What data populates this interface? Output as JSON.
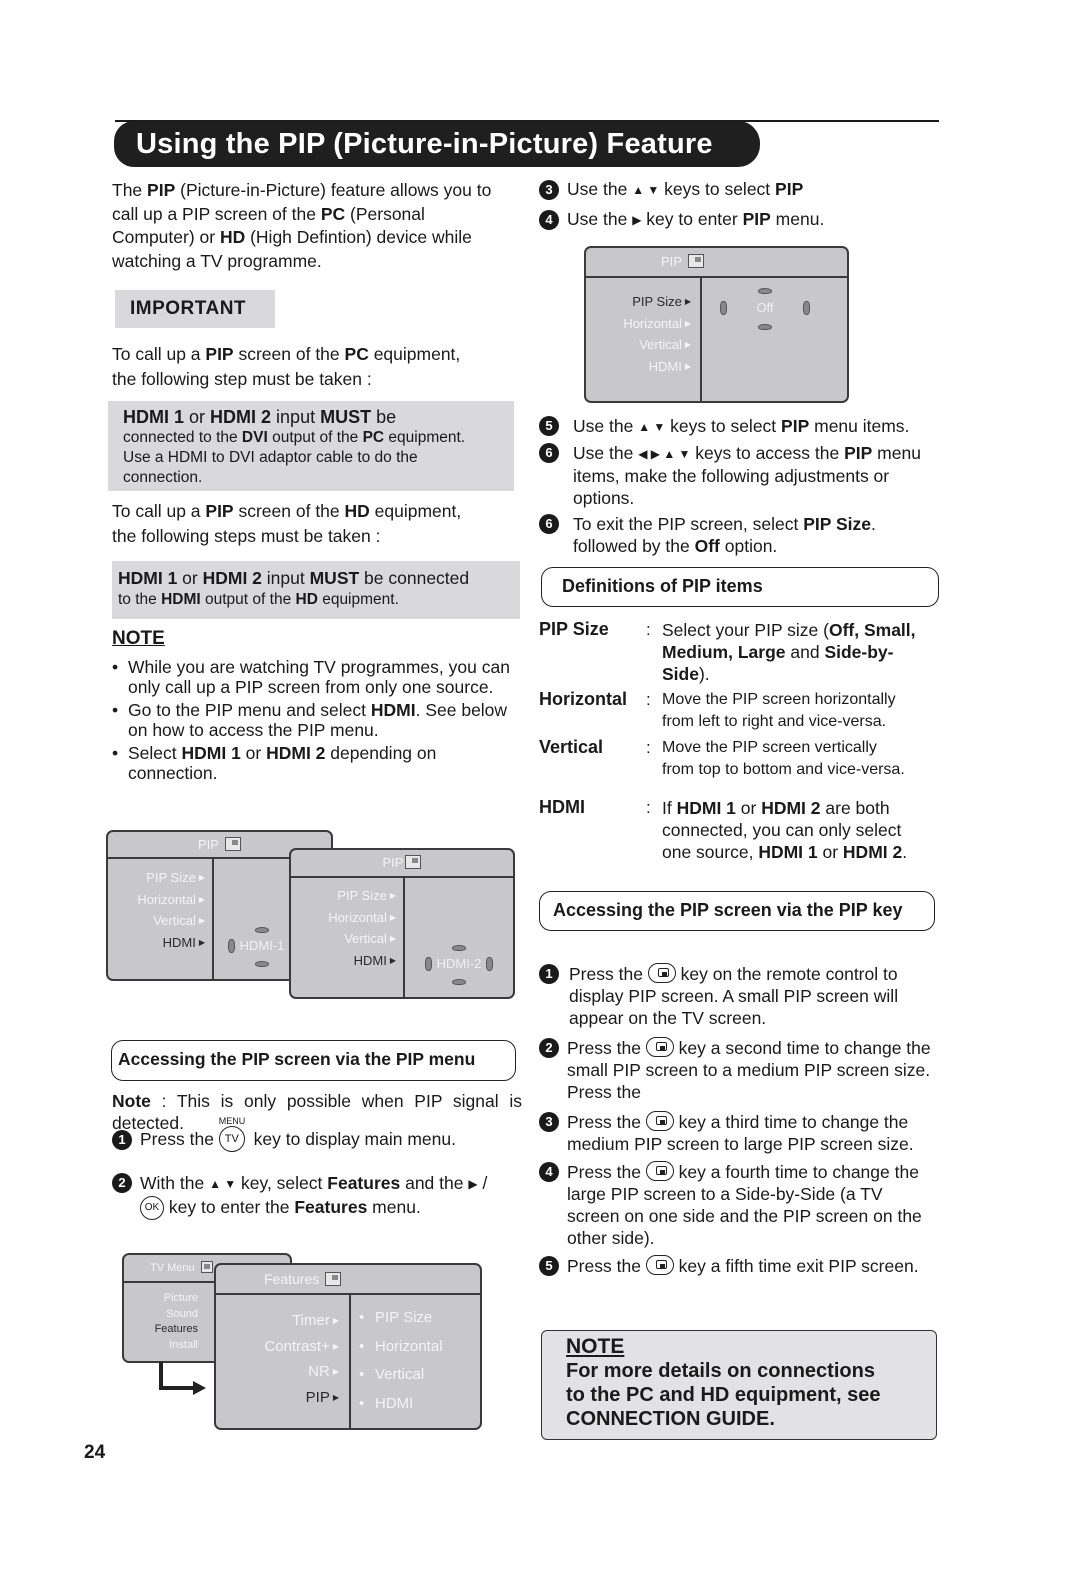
{
  "page": {
    "title": "Using the PIP (Picture-in-Picture) Feature",
    "page_number": "24"
  },
  "intro": {
    "parts": [
      "The ",
      "PIP",
      " (Picture-in-Picture) feature allows you to call up a PIP screen of the ",
      "PC",
      " (Personal Computer)  or ",
      "HD",
      " (High Defintion) device while watching a TV programme."
    ]
  },
  "important": {
    "label": "IMPORTANT",
    "pc_intro": [
      "To call up a ",
      "PIP",
      " screen of the ",
      "PC",
      " equipment,",
      " the following step must be taken :"
    ],
    "pc_box": [
      "HDMI 1",
      " or ",
      "HDMI 2",
      " input ",
      "MUST",
      " be",
      "connected to the ",
      "DVI",
      " output of the ",
      "PC",
      " equipment.",
      "Use a HDMI to DVI adaptor cable to do the",
      "connection."
    ],
    "hd_intro": [
      "To call up a ",
      "PIP",
      " screen of the ",
      "HD",
      " equipment,",
      " the following steps must be taken :"
    ],
    "hd_box": [
      "HDMI 1",
      " or ",
      "HDMI 2",
      " input ",
      "MUST",
      " be connected",
      "to the ",
      "HDMI",
      " output of the ",
      "HD",
      " equipment."
    ]
  },
  "note_left": {
    "heading": "NOTE",
    "bullets": [
      {
        "text": "While you are watching TV programmes, you can only call up a PIP screen from only one source."
      },
      {
        "parts": [
          "Go to the PIP menu and select ",
          "HDMI",
          ". See below on how to access the PIP menu."
        ]
      },
      {
        "parts": [
          "Select ",
          "HDMI 1",
          " or ",
          "HDMI 2",
          " depending on connection."
        ]
      }
    ]
  },
  "osd_hdmi1": {
    "header": "PIP",
    "items": [
      "PIP Size",
      "Horizontal",
      "Vertical",
      "HDMI"
    ],
    "selected_index": 3,
    "value": "HDMI-1"
  },
  "osd_hdmi2": {
    "header": "PIP",
    "items": [
      "PIP Size",
      "Horizontal",
      "Vertical",
      "HDMI"
    ],
    "selected_index": 3,
    "value": "HDMI-2"
  },
  "via_menu": {
    "heading": "Accessing the PIP screen via the PIP menu",
    "note_label": "Note",
    "note_text": " : This is only possible when PIP signal is detected.",
    "step1": {
      "num": "1",
      "pre": "Press the ",
      "key_top": "MENU",
      "key": "TV",
      "post": " key to display main menu."
    },
    "step2": {
      "num": "2",
      "pre": "With the ",
      "arrows": "▲ ▼",
      "mid": " key, select ",
      "bold1": "Features",
      "mid2": " and the ",
      "arrow2": "▶",
      "slash": " / ",
      "key": "OK",
      "mid3": " key to enter the ",
      "bold2": "Features",
      "post": " menu."
    }
  },
  "osd_tvmenu": {
    "header": "TV Menu",
    "items": [
      "Picture",
      "Sound",
      "Features",
      "Install"
    ],
    "selected_index": 2
  },
  "osd_features": {
    "header": "Features",
    "items": [
      "Timer",
      "Contrast+",
      "NR",
      "PIP"
    ],
    "selected_index": 3,
    "sub_items": [
      "PIP Size",
      "Horizontal",
      "Vertical",
      "HDMI"
    ]
  },
  "right_steps_top": [
    {
      "num": "3",
      "pre": "Use the ",
      "arrows": "▲ ▼",
      "mid": " keys to select ",
      "bold": "PIP",
      "post": ""
    },
    {
      "num": "4",
      "pre": "Use the ",
      "arrows": "▶",
      "mid": " key to enter ",
      "bold": "PIP",
      "post": " menu."
    }
  ],
  "osd_pip": {
    "header": "PIP",
    "items": [
      "PIP Size",
      "Horizontal",
      "Vertical",
      "HDMI"
    ],
    "selected_index": 0,
    "value": "Off"
  },
  "right_steps_mid": [
    {
      "num": "5",
      "pre": "Use the ",
      "arrows": "▲ ▼",
      "mid": " keys to select ",
      "bold": "PIP",
      "post": " menu items."
    },
    {
      "num": "6",
      "pre": "Use the ",
      "arrows": "◀  ▶ ▲ ▼",
      "mid": "  keys to access the ",
      "bold": "PIP",
      "post": " menu items, make the following adjustments or options."
    },
    {
      "num": "6",
      "pre": "To exit the PIP screen, select ",
      "arrows": "",
      "mid": "",
      "bold": "PIP Size",
      "post": ".",
      "post2_pre": "followed by the ",
      "post2_bold": "Off",
      "post2": " option."
    }
  ],
  "definitions": {
    "heading": "Definitions of PIP items",
    "items": [
      {
        "term": "PIP Size",
        "desc_parts": [
          "Select your PIP size (",
          "Off, Small,",
          "Medium, Large",
          " and ",
          "Side-by-",
          "Side",
          ")."
        ]
      },
      {
        "term": "Horizontal",
        "desc_lines": [
          "Move the PIP screen horizontally",
          "from left to right and vice-versa."
        ]
      },
      {
        "term": "Vertical",
        "desc_lines": [
          "Move the PIP screen vertically",
          "from top to bottom and vice-versa."
        ]
      },
      {
        "term": "HDMI",
        "desc_parts": [
          "If ",
          "HDMI 1",
          " or ",
          "HDMI 2",
          " are both",
          "connected, you can only select",
          "one source, ",
          "HDMI 1",
          " or ",
          "HDMI 2",
          "."
        ]
      }
    ]
  },
  "via_key": {
    "heading": "Accessing the PIP screen via the PIP key",
    "steps": [
      {
        "num": "1",
        "pre": "Press the ",
        "post": " key on the remote control to display PIP screen. A small PIP screen will appear on the TV screen."
      },
      {
        "num": "2",
        "pre": "Press the ",
        "post": " key a second time to change the small PIP screen to a medium PIP screen size. Press the"
      },
      {
        "num": "3",
        "pre": "Press the ",
        "post": " key a third time to change the medium PIP screen to large PIP screen size."
      },
      {
        "num": "4",
        "pre": "Press the ",
        "post": " key a fourth time to change the large PIP screen to a Side-by-Side (a TV screen on one side and the PIP screen on the other side)."
      },
      {
        "num": "5",
        "pre": "Press the ",
        "post": " key a fifth time exit PIP screen."
      }
    ]
  },
  "note_right": {
    "heading": "NOTE",
    "lines": [
      "For more details on connections",
      "to the PC and HD equipment, see",
      "CONNECTION GUIDE."
    ]
  }
}
